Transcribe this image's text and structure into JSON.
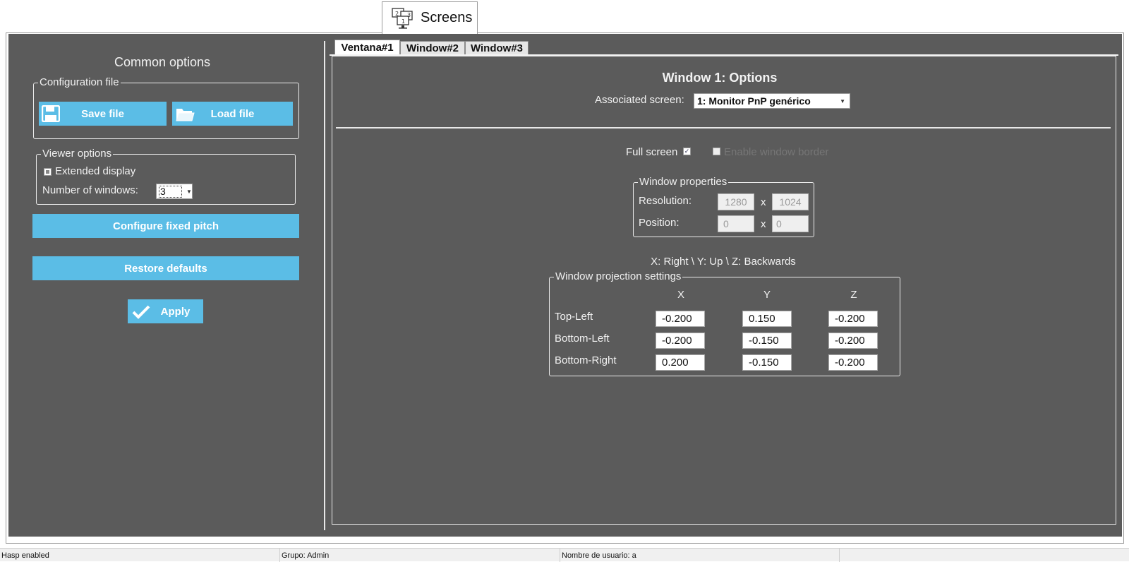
{
  "main_tab": {
    "label": "Screens",
    "icon": "screens-icon"
  },
  "common": {
    "title": "Common options",
    "config_file": {
      "legend": "Configuration file",
      "save_label": "Save file",
      "load_label": "Load file"
    },
    "viewer": {
      "legend": "Viewer options",
      "extended_display_label": "Extended display",
      "num_windows_label": "Number of windows:",
      "num_windows_value": "3"
    },
    "configure_pitch_label": "Configure fixed pitch",
    "restore_defaults_label": "Restore defaults",
    "apply_label": "Apply"
  },
  "window_tabs": [
    "Ventana#1",
    "Window#2",
    "Window#3"
  ],
  "window": {
    "title": "Window 1: Options",
    "associated_screen_label": "Associated screen:",
    "associated_screen_value": "1: Monitor PnP genérico",
    "full_screen_label": "Full screen",
    "full_screen_checked": true,
    "enable_border_label": "Enable window border",
    "properties": {
      "legend": "Window properties",
      "resolution_label": "Resolution:",
      "res_w": "1280",
      "res_h": "1024",
      "position_label": "Position:",
      "pos_x": "0",
      "pos_y": "0",
      "sep": "x"
    },
    "axes_hint": "X: Right \\ Y: Up \\ Z: Backwards",
    "projection": {
      "legend": "Window projection settings",
      "headers": [
        "X",
        "Y",
        "Z"
      ],
      "rows": [
        {
          "label": "Top-Left",
          "values": [
            "-0.200",
            "0.150",
            "-0.200"
          ]
        },
        {
          "label": "Bottom-Left",
          "values": [
            "-0.200",
            "-0.150",
            "-0.200"
          ]
        },
        {
          "label": "Bottom-Right",
          "values": [
            "0.200",
            "-0.150",
            "-0.200"
          ]
        }
      ]
    }
  },
  "status": {
    "hasp": "Hasp enabled",
    "group": "Grupo: Admin",
    "user": "Nombre de usuario: a"
  },
  "colors": {
    "panel_bg": "#5b5b5b",
    "button_blue": "#5bbde6"
  }
}
